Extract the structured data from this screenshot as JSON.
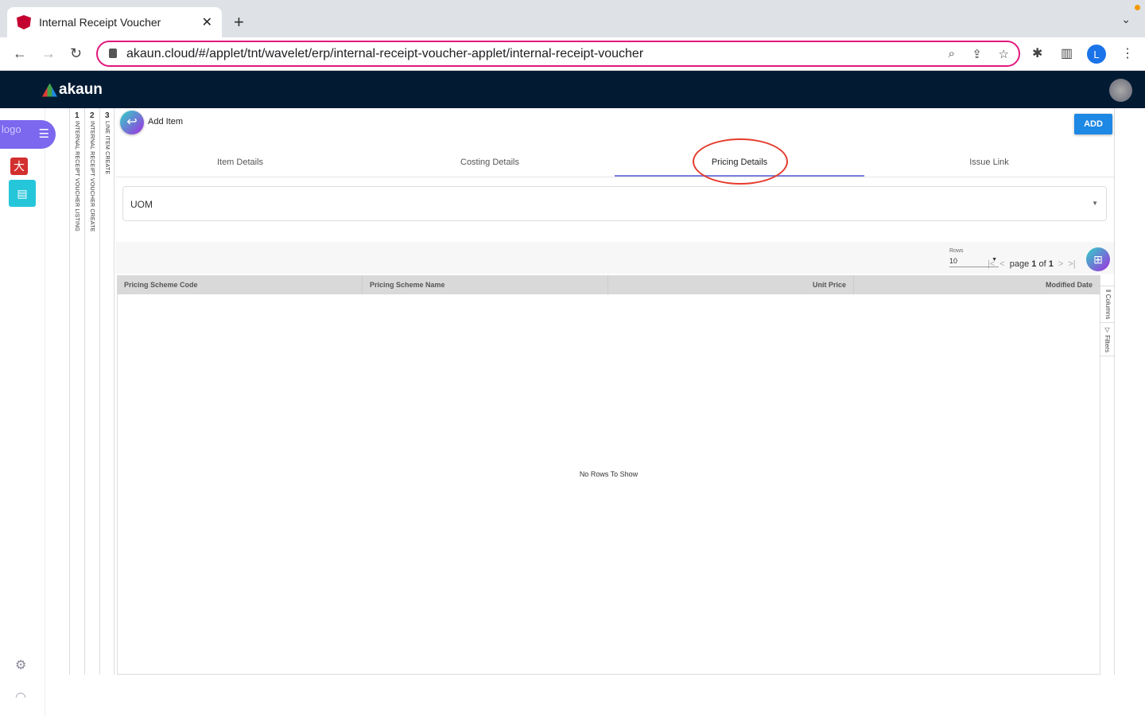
{
  "browser": {
    "tab_title": "Internal Receipt Voucher",
    "url": "akaun.cloud/#/applet/tnt/wavelet/erp/internal-receipt-voucher-applet/internal-receipt-voucher",
    "profile_initial": "L"
  },
  "app": {
    "brand": "akaun",
    "sidebar_logo_alt": "logo"
  },
  "breadcrumbs": [
    {
      "num": "1",
      "label": "INTERNAL RECEIPT VOUCHER LISTING"
    },
    {
      "num": "2",
      "label": "INTERNAL RECEIPT VOUCHER CREATE"
    },
    {
      "num": "3",
      "label": "LINE ITEM CREATE"
    }
  ],
  "page": {
    "title": "Add Item",
    "add_label": "ADD"
  },
  "tabs": [
    {
      "label": "Item Details"
    },
    {
      "label": "Costing Details"
    },
    {
      "label": "Pricing Details",
      "active": true
    },
    {
      "label": "Issue Link"
    }
  ],
  "uom": {
    "label": "UOM"
  },
  "grid": {
    "rows_label": "Rows",
    "rows_value": "10",
    "page_word": "page",
    "page": "1",
    "of_word": "of",
    "total_pages": "1",
    "columns": [
      "Pricing Scheme Code",
      "Pricing Scheme Name",
      "Unit Price",
      "Modified Date"
    ],
    "empty_text": "No Rows To Show",
    "side_columns": "Columns",
    "side_filters": "Filters"
  }
}
